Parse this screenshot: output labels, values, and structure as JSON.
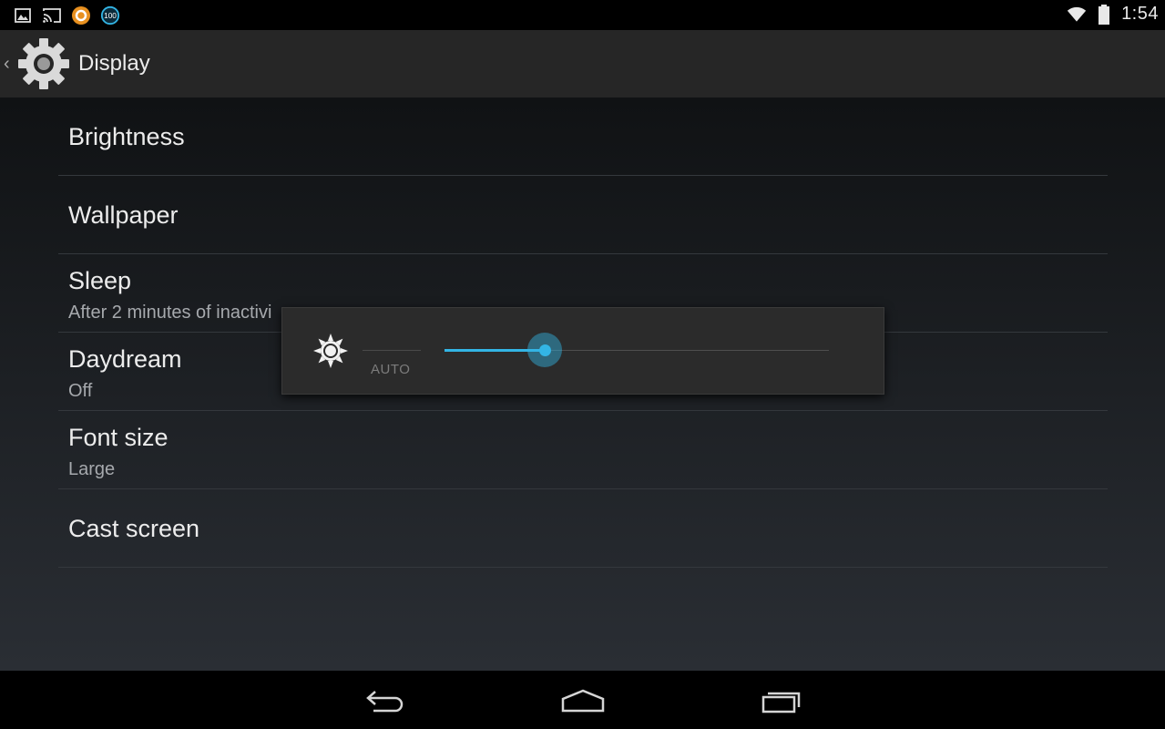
{
  "status_bar": {
    "icons_left": [
      "image-notification-icon",
      "cast-notification-icon",
      "orange-app-notification-icon",
      "battery-100-badge-icon"
    ],
    "battery_badge": "100",
    "icons_right": [
      "wifi-icon",
      "battery-icon"
    ],
    "time": "1:54"
  },
  "action_bar": {
    "up_caret": "‹",
    "icon": "settings-gear-icon",
    "title": "Display"
  },
  "preferences": [
    {
      "title": "Brightness",
      "summary": ""
    },
    {
      "title": "Wallpaper",
      "summary": ""
    },
    {
      "title": "Sleep",
      "summary": "After 2 minutes of inactivi"
    },
    {
      "title": "Daydream",
      "summary": "Off"
    },
    {
      "title": "Font size",
      "summary": "Large"
    },
    {
      "title": "Cast screen",
      "summary": ""
    }
  ],
  "brightness_dialog": {
    "icon": "sun-icon",
    "auto_label": "AUTO",
    "level": 0.26,
    "accent_color": "#33b5e5"
  },
  "nav_bar": {
    "buttons": [
      "back-icon",
      "home-icon",
      "recents-icon"
    ]
  }
}
